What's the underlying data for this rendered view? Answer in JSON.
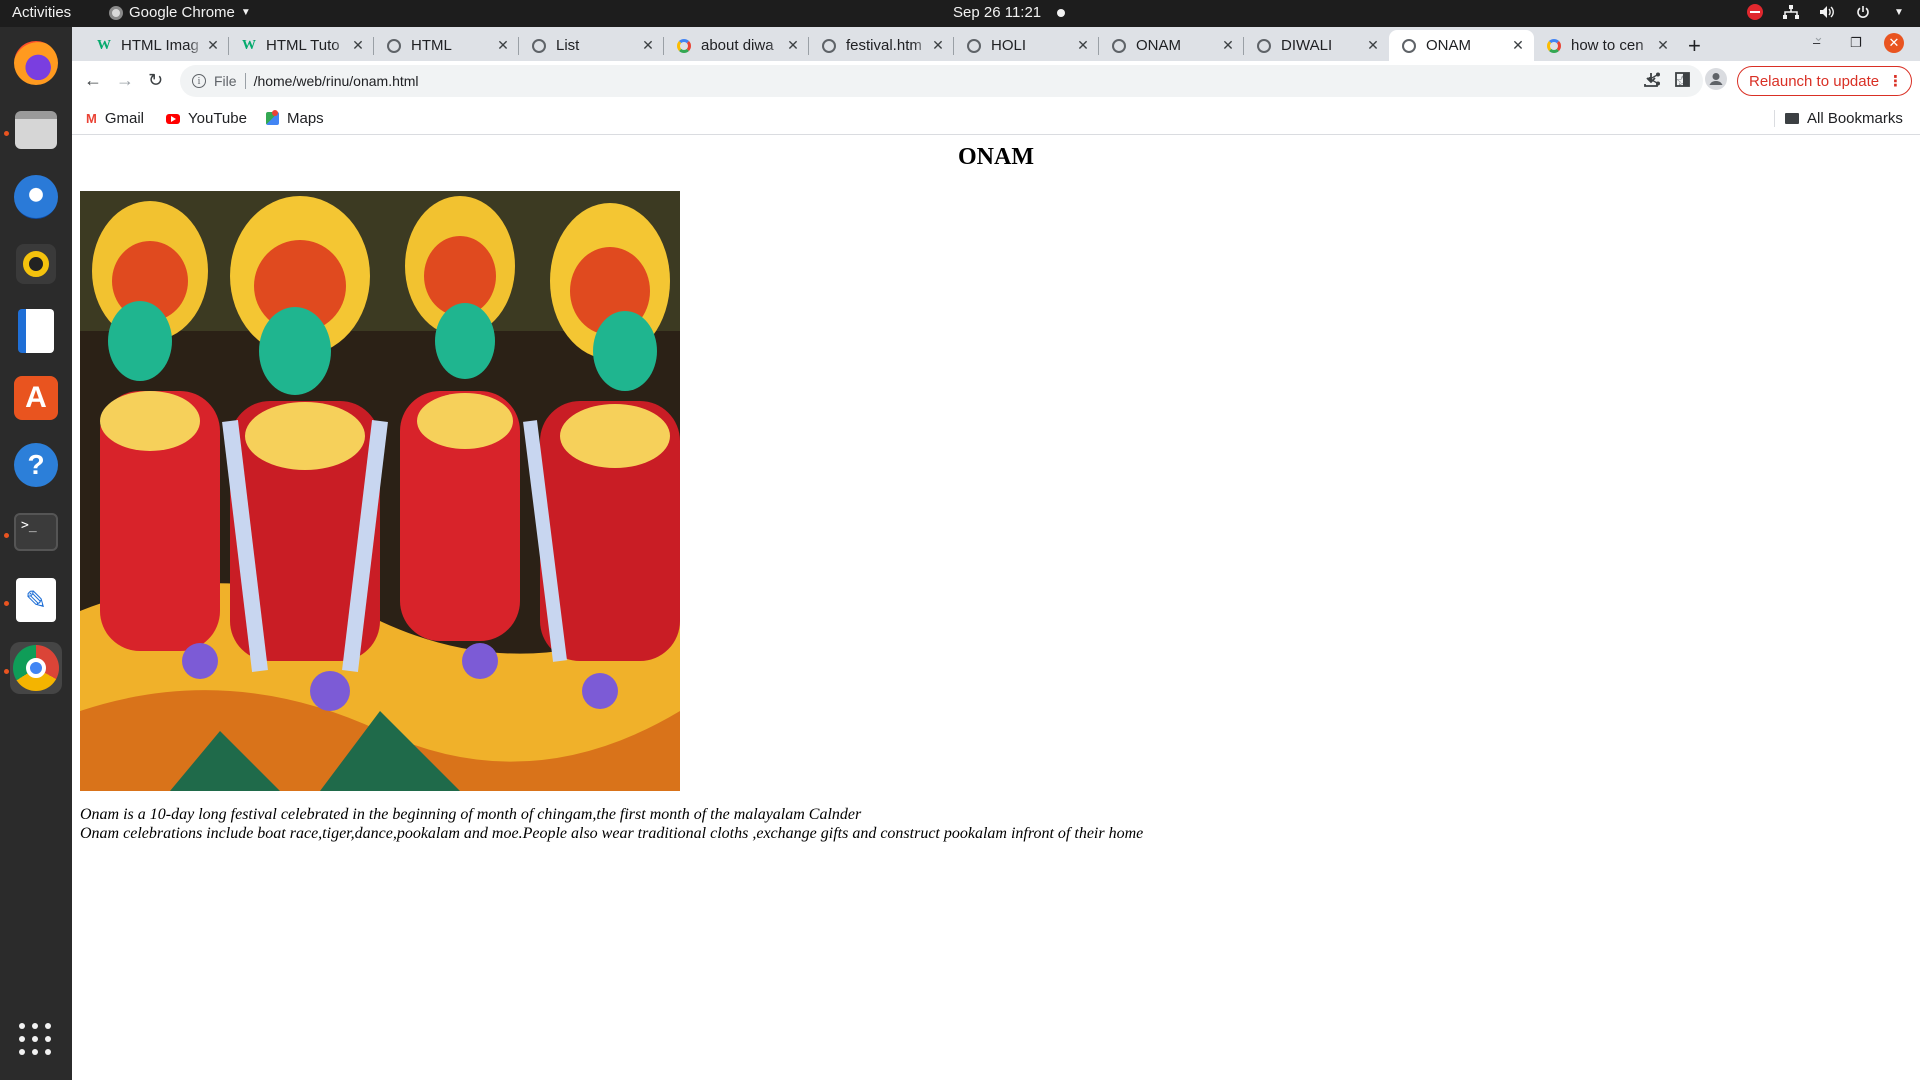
{
  "system": {
    "activities": "Activities",
    "app_menu": "Google Chrome",
    "clock": "Sep 26  11:21"
  },
  "dock": {
    "apps": [
      "Firefox",
      "Files",
      "Thunderbird",
      "Rhythmbox",
      "LibreOffice Writer",
      "Ubuntu Software",
      "Help",
      "Terminal",
      "Text Editor",
      "Google Chrome",
      "Show Applications"
    ]
  },
  "browser": {
    "tabs": [
      {
        "title": "HTML Imag",
        "icon": "w3schools-icon"
      },
      {
        "title": "HTML Tuto",
        "icon": "w3schools-icon"
      },
      {
        "title": "HTML",
        "icon": "globe-icon"
      },
      {
        "title": "List",
        "icon": "globe-icon"
      },
      {
        "title": "about diwa",
        "icon": "google-icon"
      },
      {
        "title": "festival.htm",
        "icon": "globe-icon"
      },
      {
        "title": "HOLI",
        "icon": "globe-icon"
      },
      {
        "title": "ONAM",
        "icon": "globe-icon"
      },
      {
        "title": "DIWALI",
        "icon": "globe-icon"
      },
      {
        "title": "ONAM",
        "icon": "globe-icon",
        "active": true
      },
      {
        "title": "how to cen",
        "icon": "google-icon"
      }
    ],
    "address": {
      "scheme_label": "File",
      "url": "/home/web/rinu/onam.html"
    },
    "relaunch_label": "Relaunch to update",
    "bookmarks": [
      "Gmail",
      "YouTube",
      "Maps"
    ],
    "all_bookmarks": "All Bookmarks"
  },
  "page": {
    "heading": "ONAM",
    "image_alt": "Onam festival dancers in traditional costume",
    "line1": "Onam is a 10-day long festival celebrated in the beginning of month of chingam,the first month of the malayalam Calnder",
    "line2": "Onam celebrations include boat race,tiger,dance,pookalam and moe.People also wear traditional cloths ,exchange gifts and construct pookalam infront of their home"
  },
  "colors": {
    "accent": "#e95420",
    "relaunch": "#d93025",
    "tabstrip": "#dee1e6"
  }
}
